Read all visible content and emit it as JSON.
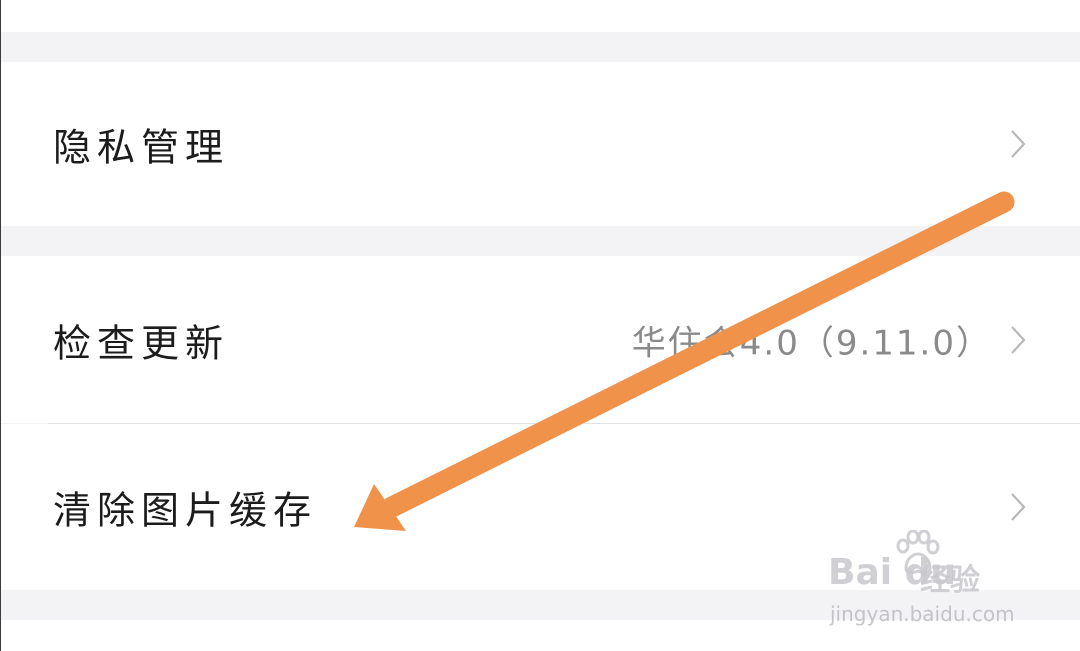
{
  "settings": {
    "items": [
      {
        "label": "隐私管理",
        "value": ""
      },
      {
        "label": "检查更新",
        "value": "华住会4.0（9.11.0）"
      },
      {
        "label": "清除图片缓存",
        "value": ""
      }
    ]
  },
  "annotation": {
    "arrow_color": "#f0924a"
  },
  "watermark": {
    "brand": "Bai  du",
    "brand_cn": "经验",
    "url": "jingyan.baidu.com"
  },
  "icons": {
    "chevron": "chevron-right-icon",
    "paw": "baidu-paw-icon"
  }
}
